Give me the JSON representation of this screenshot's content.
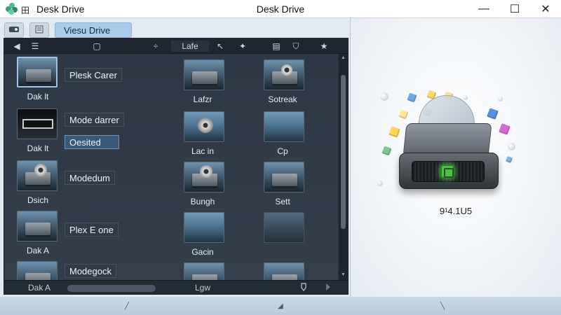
{
  "titlebar": {
    "mini_label": "田",
    "left_title": "Desk Drive",
    "center_title": "Desk Drive",
    "buttons": {
      "minimize": "—",
      "maximize": "☐",
      "close": "✕"
    }
  },
  "toolbar": {
    "view_tab_label": "Viesu Drive",
    "icons": [
      "drive-icon",
      "list-icon"
    ]
  },
  "nav": {
    "items": [
      "◀",
      "☰",
      "▢",
      "÷",
      "Lafe",
      "↖",
      "✦",
      "▤",
      "⛉",
      "★"
    ]
  },
  "grid": {
    "left_column": [
      {
        "caption": "Dak lt",
        "name": "Plesk Carer",
        "active": false
      },
      {
        "caption": "Dak lt",
        "name": "Mode darrer",
        "active": false
      },
      {
        "caption": "",
        "name": "Oesited",
        "active": true
      },
      {
        "caption": "Dsich",
        "name": "Modedum",
        "active": false
      },
      {
        "caption": "Dak A",
        "name": "Plex E one",
        "active": false
      },
      {
        "caption": "",
        "name": "Modegock",
        "active": false
      }
    ],
    "middle_column": [
      "Lafzr",
      "Lac in",
      "Bungh",
      "Gacin",
      ""
    ],
    "right_column": [
      "Sotreak",
      "Cp",
      "Sett",
      ""
    ]
  },
  "bottom_bar": {
    "left_text": "Dak A",
    "center_text": "Lgw",
    "icons": [
      "tag-icon",
      "play-icon"
    ]
  },
  "preview": {
    "caption": "9¹4.1U5"
  },
  "colors": {
    "accent": "#a9cbe8",
    "browser_bg": "#2b3340",
    "led": "#4fc04a"
  }
}
